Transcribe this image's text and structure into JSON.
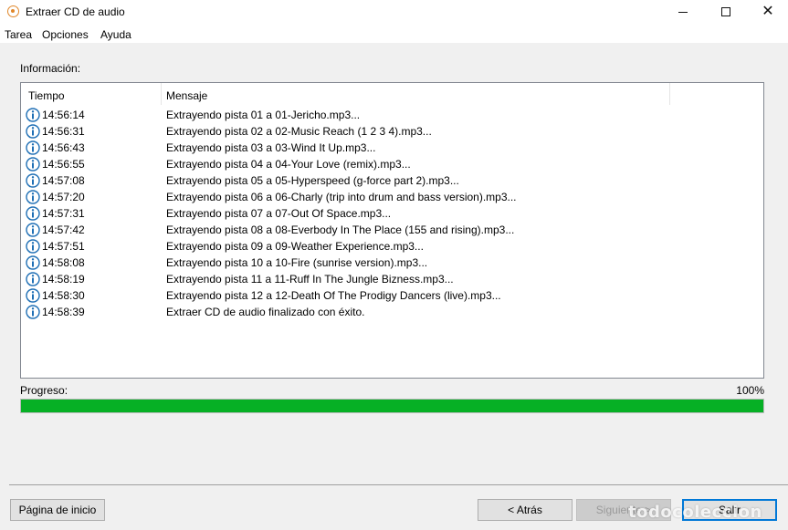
{
  "window": {
    "title": "Extraer CD de audio"
  },
  "menu": {
    "items": [
      "Tarea",
      "Opciones",
      "Ayuda"
    ]
  },
  "info": {
    "label": "Información:"
  },
  "list": {
    "columns": [
      "Tiempo",
      "Mensaje"
    ],
    "rows": [
      {
        "icon": "info-icon",
        "time": "14:56:14",
        "message": "Extrayendo pista 01 a 01-Jericho.mp3..."
      },
      {
        "icon": "info-icon",
        "time": "14:56:31",
        "message": "Extrayendo pista 02 a 02-Music Reach (1 2 3 4).mp3..."
      },
      {
        "icon": "info-icon",
        "time": "14:56:43",
        "message": "Extrayendo pista 03 a 03-Wind It Up.mp3..."
      },
      {
        "icon": "info-icon",
        "time": "14:56:55",
        "message": "Extrayendo pista 04 a 04-Your Love (remix).mp3..."
      },
      {
        "icon": "info-icon",
        "time": "14:57:08",
        "message": "Extrayendo pista 05 a 05-Hyperspeed (g-force part 2).mp3..."
      },
      {
        "icon": "info-icon",
        "time": "14:57:20",
        "message": "Extrayendo pista 06 a 06-Charly (trip into drum and bass version).mp3..."
      },
      {
        "icon": "info-icon",
        "time": "14:57:31",
        "message": "Extrayendo pista 07 a 07-Out Of Space.mp3..."
      },
      {
        "icon": "info-icon",
        "time": "14:57:42",
        "message": "Extrayendo pista 08 a 08-Everbody In The Place (155 and rising).mp3..."
      },
      {
        "icon": "info-icon",
        "time": "14:57:51",
        "message": "Extrayendo pista 09 a 09-Weather Experience.mp3..."
      },
      {
        "icon": "info-icon",
        "time": "14:58:08",
        "message": "Extrayendo pista 10 a 10-Fire (sunrise version).mp3..."
      },
      {
        "icon": "info-icon",
        "time": "14:58:19",
        "message": "Extrayendo pista 11 a 11-Ruff In The Jungle Bizness.mp3..."
      },
      {
        "icon": "info-icon",
        "time": "14:58:30",
        "message": "Extrayendo pista 12 a 12-Death Of The Prodigy Dancers (live).mp3..."
      },
      {
        "icon": "info-icon",
        "time": "14:58:39",
        "message": "Extraer CD de audio finalizado con éxito."
      }
    ]
  },
  "progress": {
    "label": "Progreso:",
    "percent_text": "100%",
    "value": 100,
    "color": "#06b025"
  },
  "buttons": {
    "home": "Página de inicio",
    "back": "< Atrás",
    "next": "Siguiente >",
    "exit": "Salir"
  },
  "watermark": "todocoleccion"
}
